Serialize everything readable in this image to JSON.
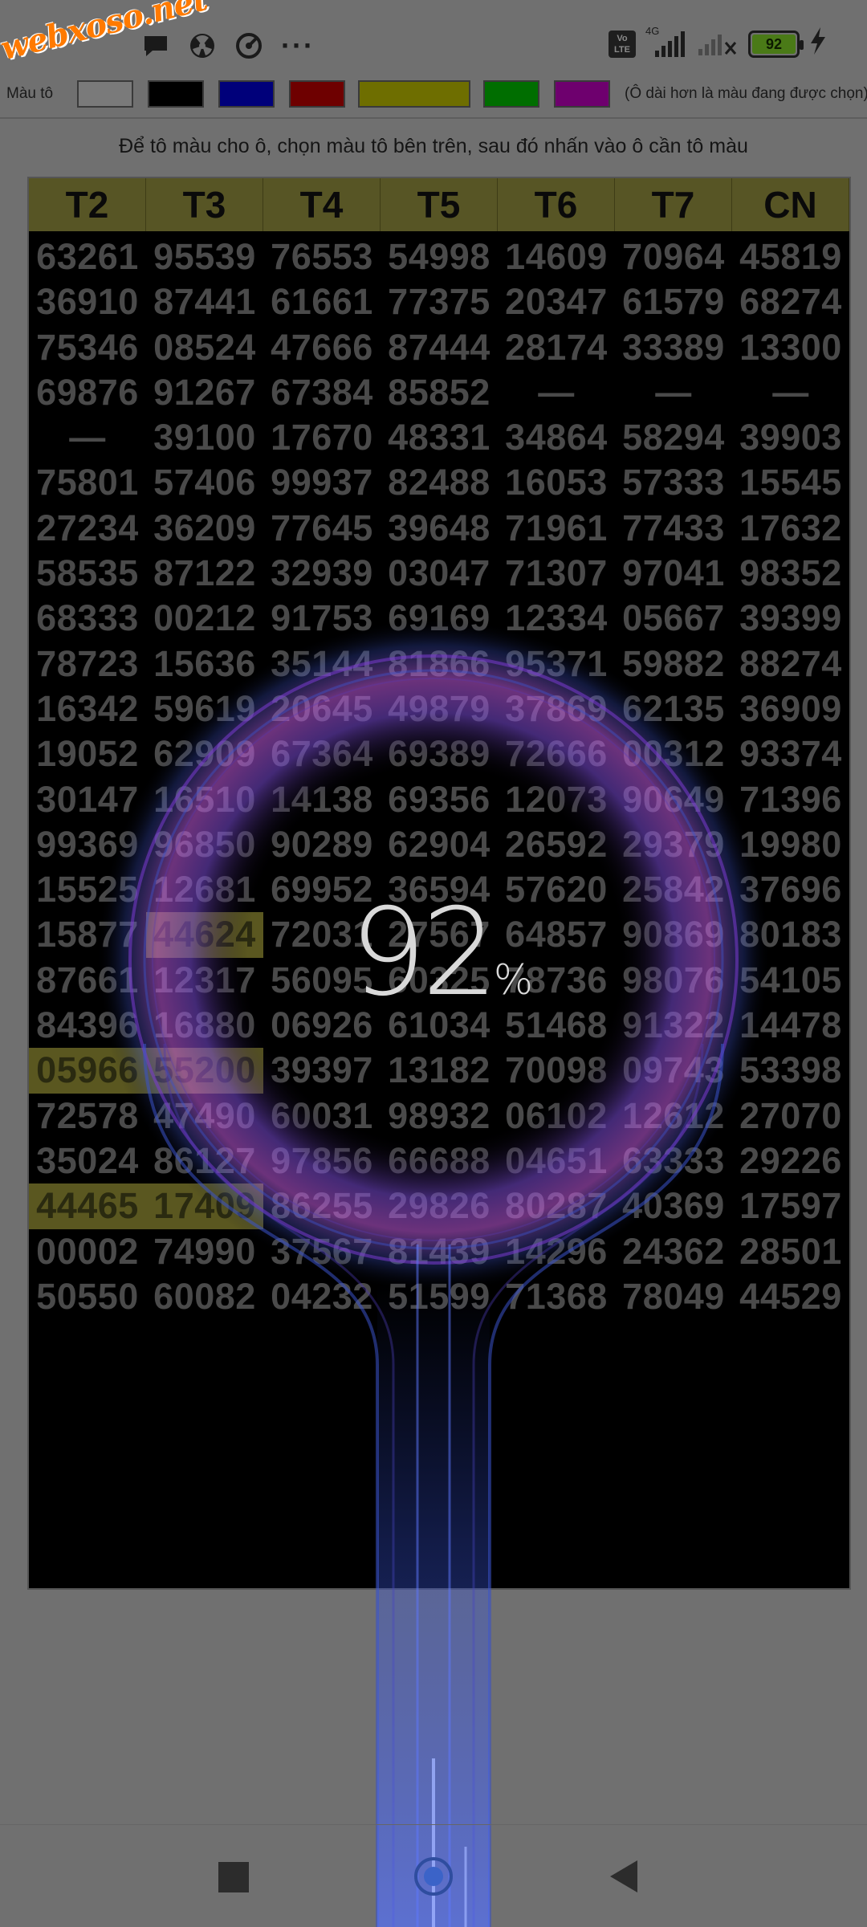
{
  "status_bar": {
    "logo_text": "webxoso.net",
    "volte_label": "Vo LTE",
    "network_label": "4G",
    "battery_level": "92"
  },
  "palette": {
    "label": "Màu tô",
    "note": "(Ô dài hơn là màu đang được chọn)",
    "colors": [
      "#c8c8c8",
      "#000000",
      "#00007a",
      "#6e0000",
      "#6e6e00",
      "#006e00",
      "#6e006e"
    ]
  },
  "instruction": "Để tô màu cho ô, chọn màu tô bên trên, sau đó nhấn vào ô cần tô màu",
  "table": {
    "headers": [
      "T2",
      "T3",
      "T4",
      "T5",
      "T6",
      "T7",
      "CN"
    ],
    "rows": [
      [
        "63261",
        "95539",
        "76553",
        "54998",
        "14609",
        "70964",
        "45819"
      ],
      [
        "36910",
        "87441",
        "61661",
        "77375",
        "20347",
        "61579",
        "68274"
      ],
      [
        "75346",
        "08524",
        "47666",
        "87444",
        "28174",
        "33389",
        "13300"
      ],
      [
        "69876",
        "91267",
        "67384",
        "85852",
        "—",
        "—",
        "—"
      ],
      [
        "—",
        "39100",
        "17670",
        "48331",
        "34864",
        "58294",
        "39903"
      ],
      [
        "75801",
        "57406",
        "99937",
        "82488",
        "16053",
        "57333",
        "15545"
      ],
      [
        "27234",
        "36209",
        "77645",
        "39648",
        "71961",
        "77433",
        "17632"
      ],
      [
        "58535",
        "87122",
        "32939",
        "03047",
        "71307",
        "97041",
        "98352"
      ],
      [
        "68333",
        "00212",
        "91753",
        "69169",
        "12334",
        "05667",
        "39399"
      ],
      [
        "78723",
        "15636",
        "35144",
        "81866",
        "95371",
        "59882",
        "88274"
      ],
      [
        "16342",
        "59619",
        "20645",
        "49879",
        "37869",
        "62135",
        "36909"
      ],
      [
        "19052",
        "62909",
        "67364",
        "69389",
        "72666",
        "00312",
        "93374"
      ],
      [
        "30147",
        "16510",
        "14138",
        "69356",
        "12073",
        "90649",
        "71396"
      ],
      [
        "99369",
        "96850",
        "90289",
        "62904",
        "26592",
        "29379",
        "19980"
      ],
      [
        "15525",
        "12681",
        "69952",
        "36594",
        "57620",
        "25842",
        "37696"
      ],
      [
        "15877",
        "44624",
        "72031",
        "27567",
        "64857",
        "90869",
        "80183"
      ],
      [
        "87661",
        "12317",
        "56095",
        "60325",
        "78736",
        "98076",
        "54105"
      ],
      [
        "84396",
        "16880",
        "06926",
        "61034",
        "51468",
        "91322",
        "14478"
      ],
      [
        "05966",
        "55200",
        "39397",
        "13182",
        "70098",
        "09743",
        "53398"
      ],
      [
        "72578",
        "47490",
        "60031",
        "98932",
        "06102",
        "12612",
        "27070"
      ],
      [
        "35024",
        "86127",
        "97856",
        "66688",
        "04651",
        "63333",
        "29226"
      ],
      [
        "44465",
        "17409",
        "86255",
        "29826",
        "80287",
        "40369",
        "17597"
      ],
      [
        "00002",
        "74990",
        "37567",
        "81439",
        "14296",
        "24362",
        "28501"
      ],
      [
        "50550",
        "60082",
        "04232",
        "51599",
        "71368",
        "78049",
        "44529"
      ]
    ],
    "highlighted": [
      [
        15,
        1
      ],
      [
        18,
        0
      ],
      [
        18,
        1
      ],
      [
        21,
        0
      ],
      [
        21,
        1
      ]
    ]
  },
  "charging": {
    "value": "92",
    "sign": "%"
  },
  "nav": {
    "recents_icon": "square-icon",
    "home_icon": "circle-icon",
    "back_icon": "triangle-icon"
  }
}
